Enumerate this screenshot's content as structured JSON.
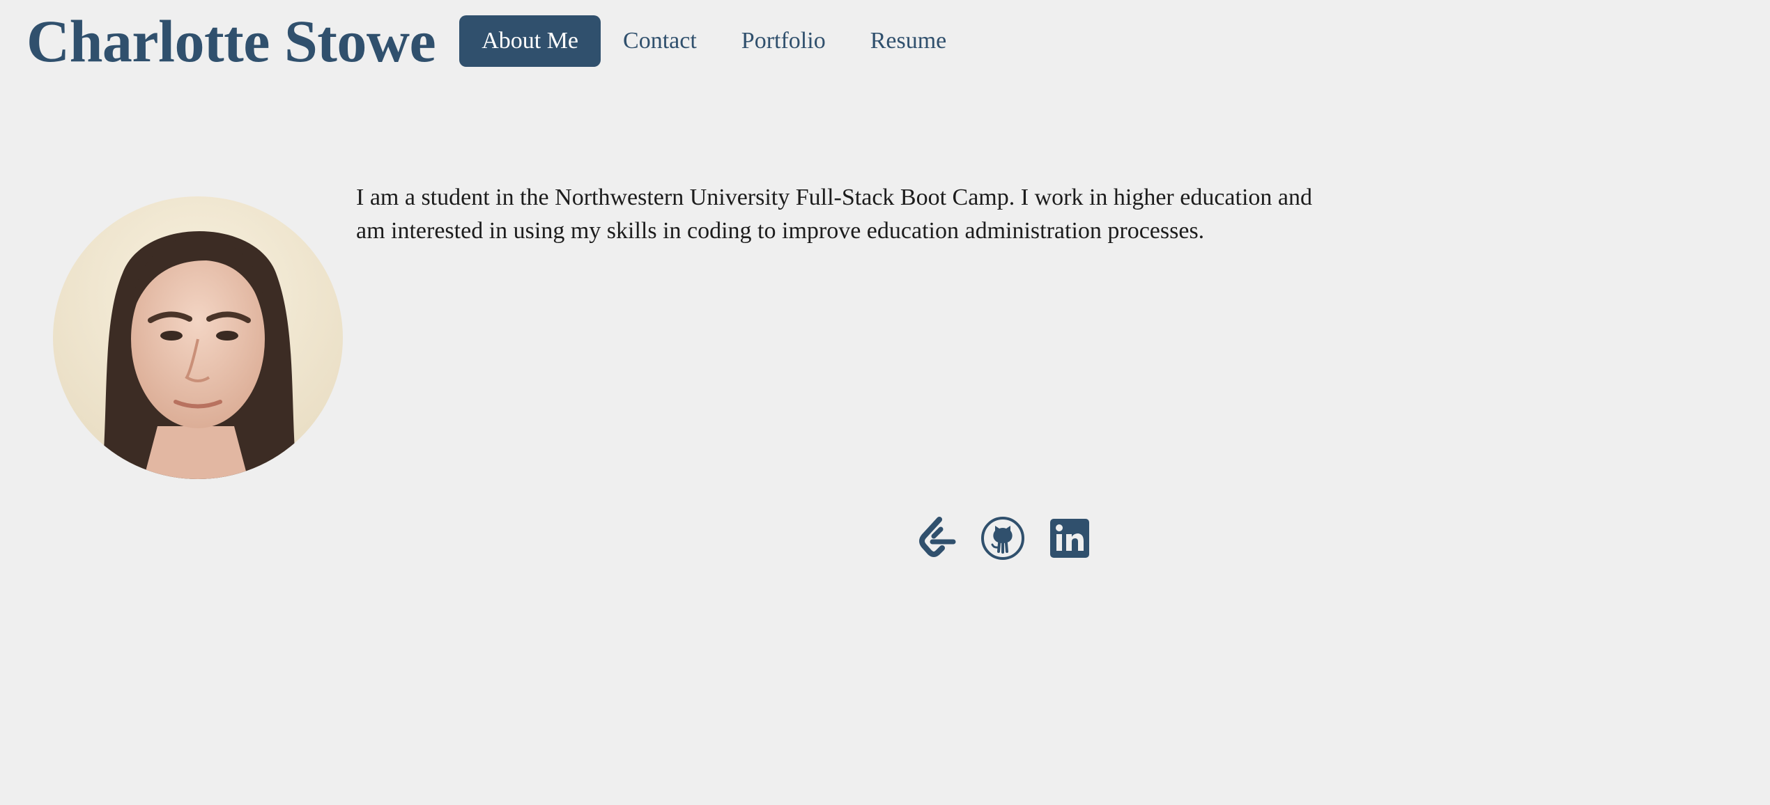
{
  "header": {
    "title": "Charlotte Stowe",
    "nav": [
      {
        "label": "About Me",
        "active": true
      },
      {
        "label": "Contact",
        "active": false
      },
      {
        "label": "Portfolio",
        "active": false
      },
      {
        "label": "Resume",
        "active": false
      }
    ]
  },
  "about": {
    "bio": "I am a student in the Northwestern University Full-Stack Boot Camp. I work in higher education and am interested in using my skills in coding to improve education administration processes.",
    "photo_alt": "Charlotte Stowe"
  },
  "social": [
    {
      "icon": "leetcode-icon",
      "label": "LeetCode"
    },
    {
      "icon": "github-icon",
      "label": "GitHub"
    },
    {
      "icon": "linkedin-icon",
      "label": "LinkedIn"
    }
  ],
  "colors": {
    "accent": "#30506d",
    "background": "#efefef",
    "text": "#1c1c1c"
  }
}
